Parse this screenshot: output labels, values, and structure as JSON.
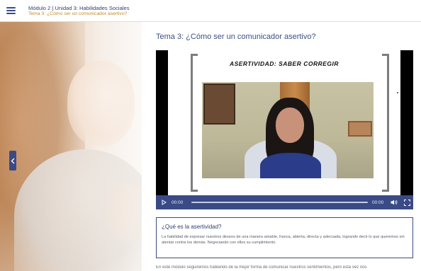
{
  "header": {
    "breadcrumb_main": "Módulo 2 | Unidad 3: Habilidades Sociales",
    "breadcrumb_sub": "Tema 3: ¿Cómo ser un comunicador asertivo?",
    "menu_icon": "hamburger-menu-icon"
  },
  "colors": {
    "primary": "#3a4a86",
    "accent": "#c08a2a"
  },
  "lesson": {
    "title": "Tema 3: ¿Cómo ser un comunicador asertivo?"
  },
  "video": {
    "slide_title": "ASERTIVIDAD: SABER CORREGIR",
    "current_time": "00:00",
    "duration": "00:00",
    "progress": 0
  },
  "info_box": {
    "title": "¿Qué es la asertividad?",
    "text": "La habilidad de expresar nuestros deseos de una manera amable, franca, abierta, directa y adecuada, logrando decir lo que queremos sin atentar contra los demás. Negociando con ellos su cumplimiento."
  },
  "footer": {
    "text": "En este módulo seguiremos hablando de la mejor forma de comunicar nuestros sentimientos, pero esta vez nos"
  }
}
